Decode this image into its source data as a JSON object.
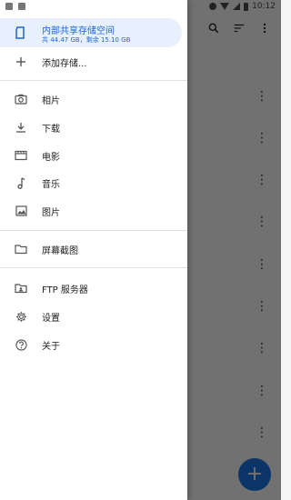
{
  "status": {
    "time": "10:12"
  },
  "drawer": {
    "storage": {
      "label": "内部共享存储空间",
      "sub": "共 44.47 GB，剩余 15.10 GB"
    },
    "add_storage": "添加存储...",
    "items": [
      {
        "icon": "camera-icon",
        "label": "相片"
      },
      {
        "icon": "download-icon",
        "label": "下载"
      },
      {
        "icon": "movie-icon",
        "label": "电影"
      },
      {
        "icon": "music-note-icon",
        "label": "音乐"
      },
      {
        "icon": "image-icon",
        "label": "图片"
      }
    ],
    "screenshots": "屏幕截图",
    "ftp": "FTP 服务器",
    "settings": "设置",
    "about": "关于"
  },
  "colors": {
    "accent": "#1967d2",
    "fab": "#1a73e8",
    "selected_bg": "#e8f0fe"
  }
}
